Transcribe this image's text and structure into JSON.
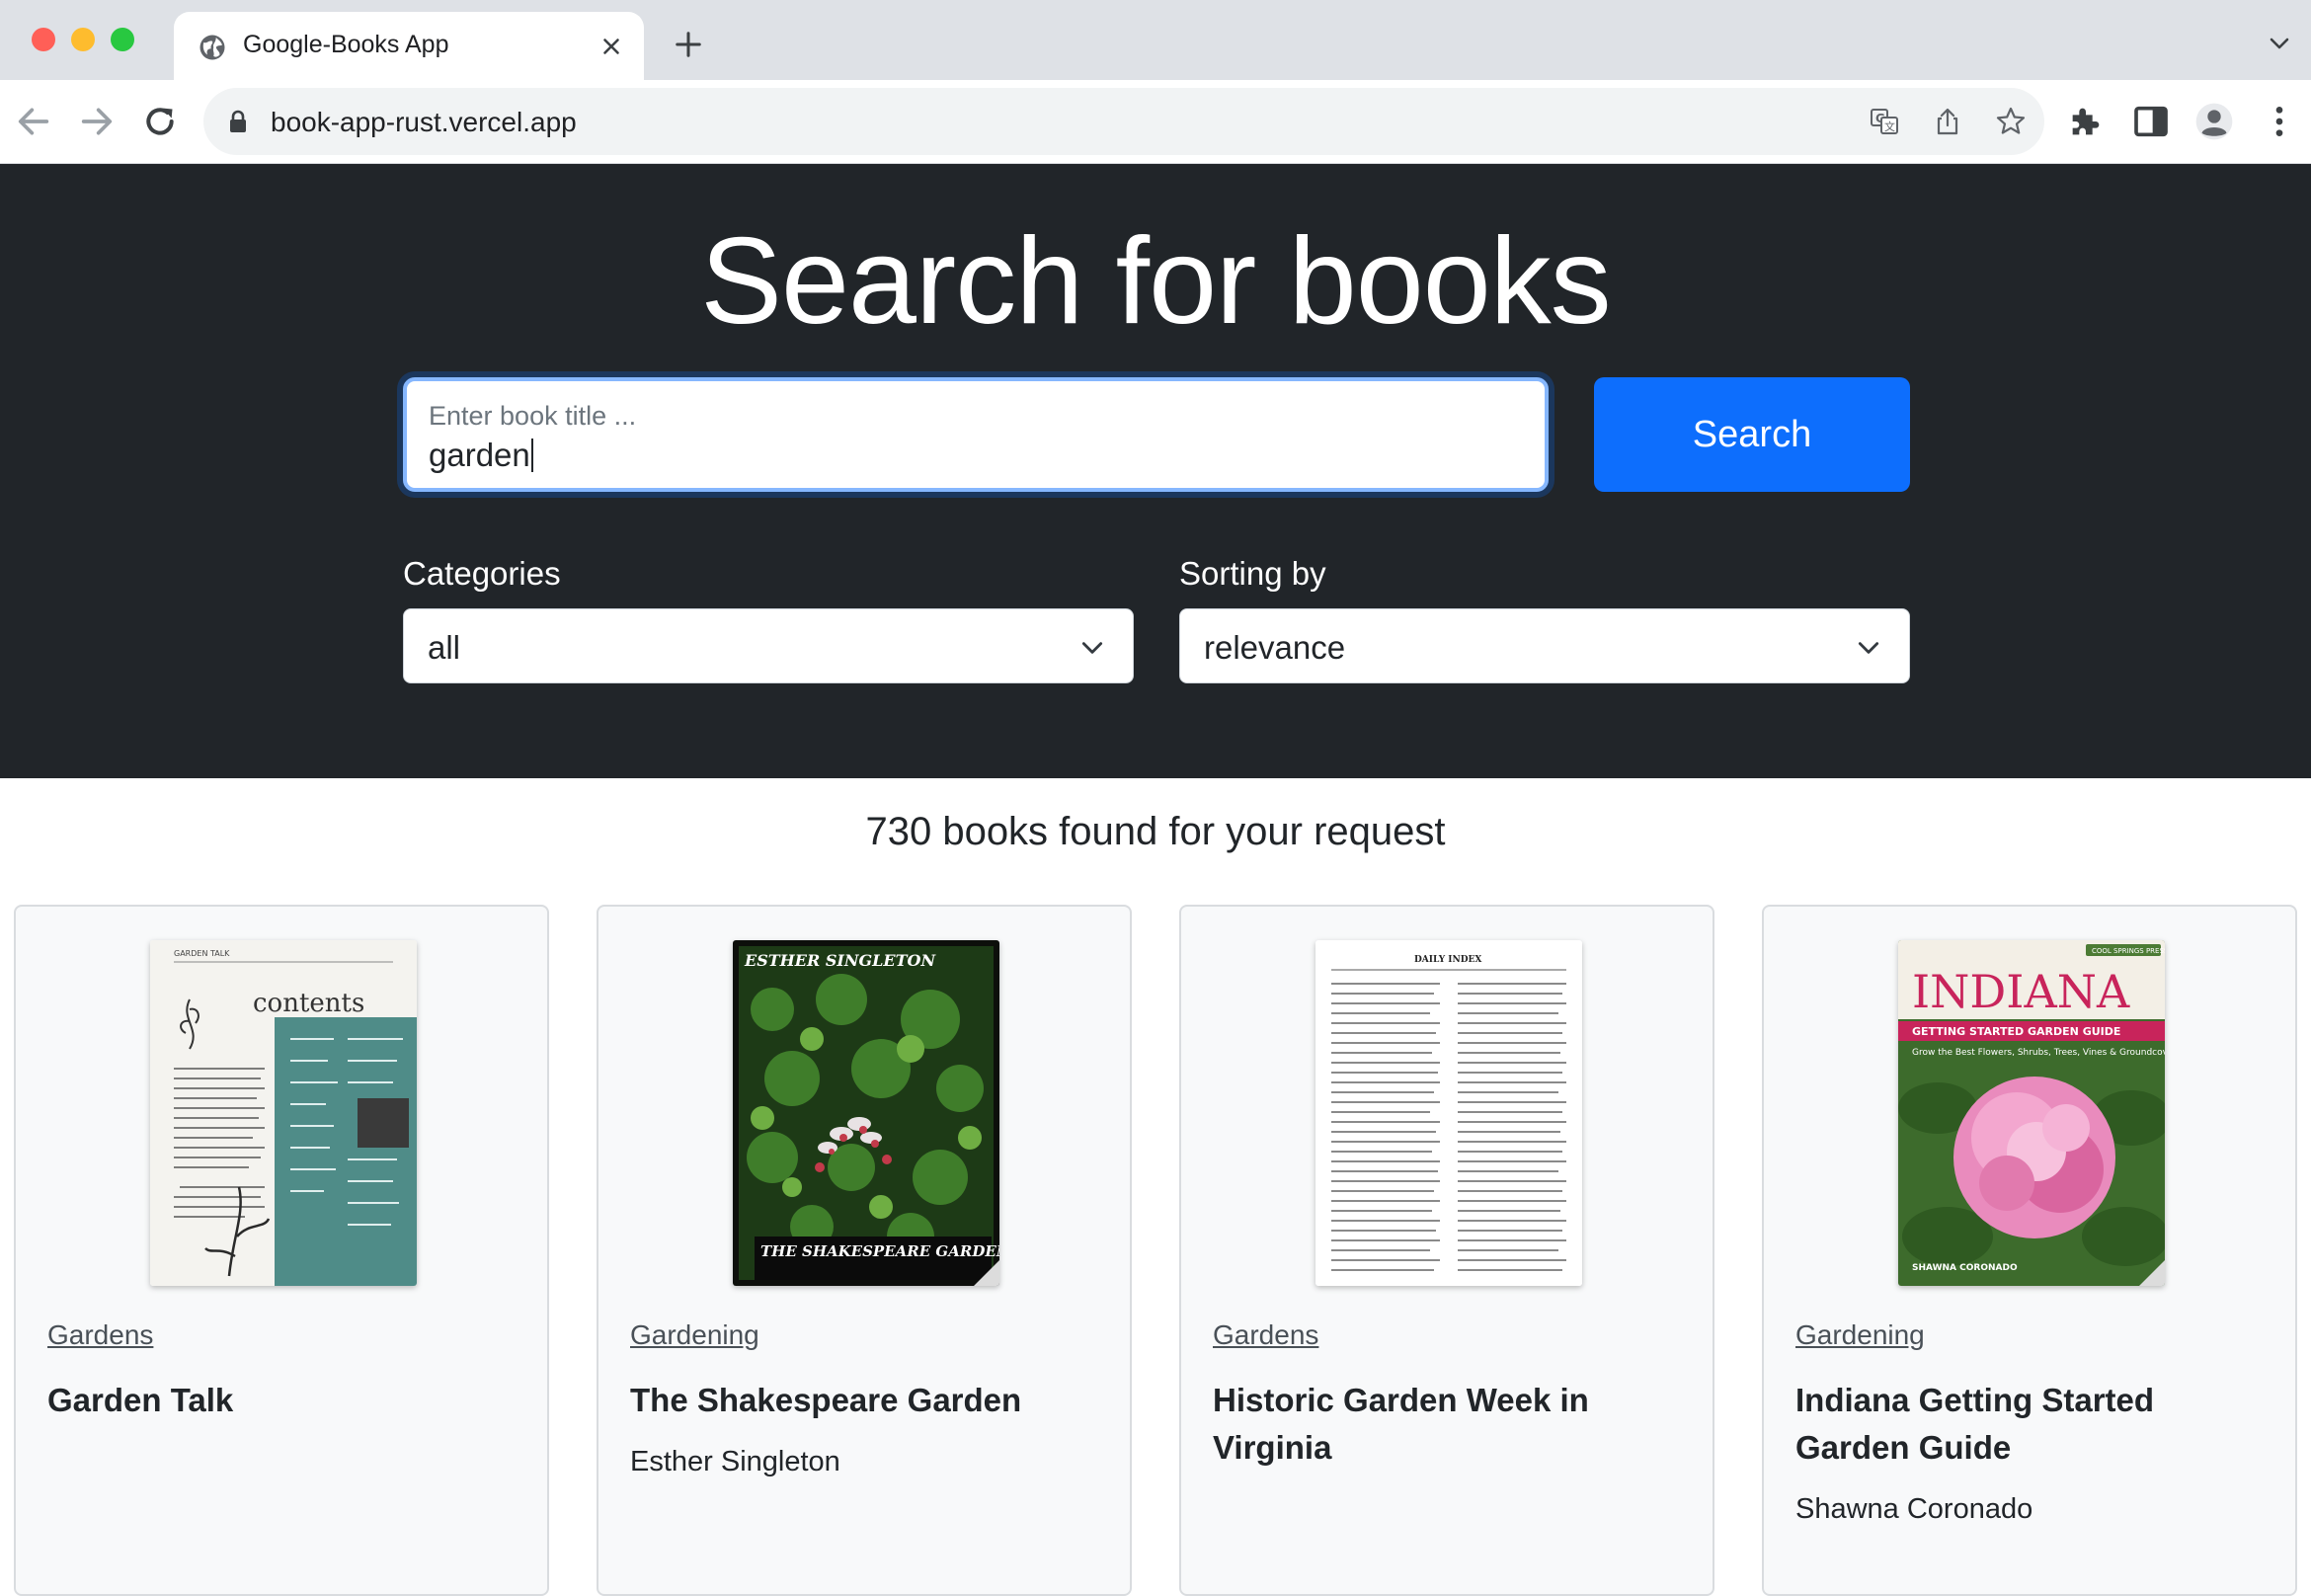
{
  "browser": {
    "tab_title": "Google-Books App",
    "url": "book-app-rust.vercel.app"
  },
  "header": {
    "title": "Search for books",
    "search": {
      "placeholder": "Enter book title ...",
      "value": "garden"
    },
    "search_button": "Search",
    "categories": {
      "label": "Categories",
      "selected": "all"
    },
    "sorting": {
      "label": "Sorting by",
      "selected": "relevance"
    }
  },
  "results": {
    "count_text": "730 books found for your request",
    "books": [
      {
        "category": "Gardens",
        "title": "Garden Talk",
        "author": ""
      },
      {
        "category": "Gardening",
        "title": "The Shakespeare Garden",
        "author": "Esther Singleton"
      },
      {
        "category": "Gardens",
        "title": "Historic Garden Week in Virginia",
        "author": ""
      },
      {
        "category": "Gardening",
        "title": "Indiana Getting Started Garden Guide",
        "author": "Shawna Coronado"
      }
    ]
  },
  "covers": {
    "garden_talk": {
      "header": "GARDEN TALK",
      "heading": "contents"
    },
    "shakespeare": {
      "author": "ESTHER SINGLETON",
      "title": "THE SHAKESPEARE GARDEN"
    },
    "historic": {
      "heading": "DAILY INDEX"
    },
    "indiana": {
      "badge": "COOL SPRINGS PRESS",
      "title": "INDIANA",
      "subtitle": "GETTING STARTED GARDEN GUIDE",
      "tagline": "Grow the Best Flowers, Shrubs, Trees, Vines & Groundcovers",
      "author": "SHAWNA CORONADO"
    }
  },
  "colors": {
    "header_bg": "#212529",
    "primary": "#0d6efd",
    "card_bg": "#f8f9fa"
  },
  "icons": {
    "tab_favicon": "globe-icon",
    "lock": "lock-icon",
    "translate": "translate-icon",
    "share": "share-icon",
    "bookmark": "star-icon",
    "extensions": "puzzle-icon",
    "side_panel": "side-panel-icon",
    "profile": "profile-icon",
    "menu": "kebab-menu-icon"
  }
}
